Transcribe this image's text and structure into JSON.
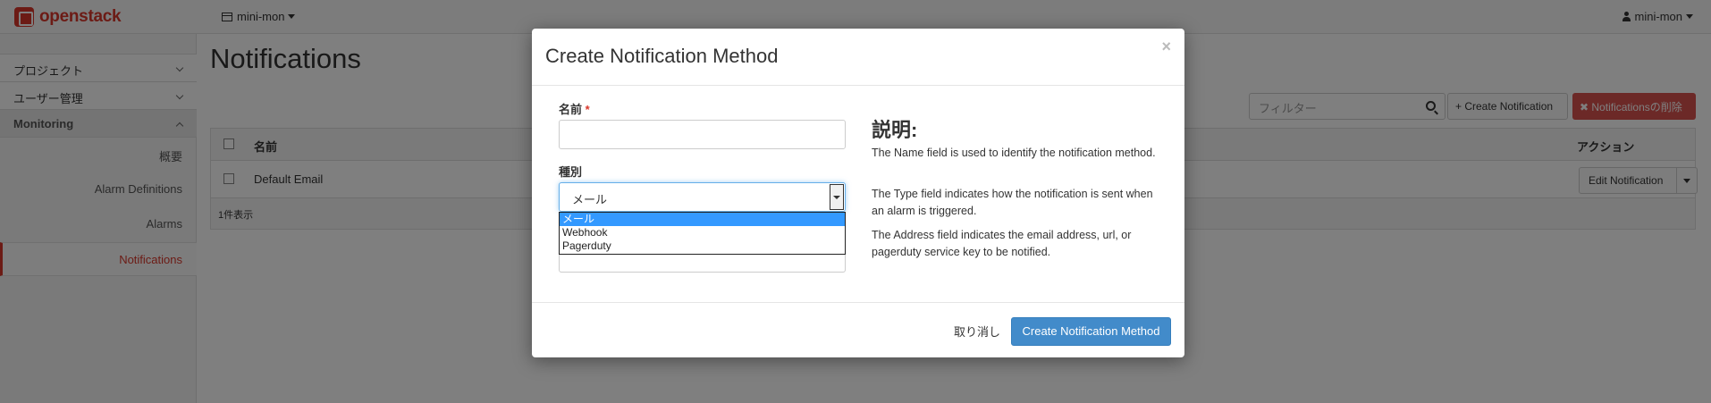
{
  "topbar": {
    "brand": "openstack",
    "project_switcher": "mini-mon",
    "user_menu": "mini-mon"
  },
  "sidebar": {
    "groups": [
      {
        "label": "プロジェクト"
      },
      {
        "label": "ユーザー管理"
      },
      {
        "label": "Monitoring"
      }
    ],
    "items": [
      {
        "label": "概要"
      },
      {
        "label": "Alarm Definitions"
      },
      {
        "label": "Alarms"
      },
      {
        "label": "Notifications"
      }
    ]
  },
  "main": {
    "title": "Notifications",
    "filter_placeholder": "フィルター",
    "create_button": "Create Notification",
    "delete_button": "Notificationsの削除",
    "table": {
      "headers": {
        "name": "名前",
        "action": "アクション"
      },
      "rows": [
        {
          "name": "Default Email",
          "action": "Edit Notification"
        }
      ],
      "footer": "1件表示"
    }
  },
  "modal": {
    "title": "Create Notification Method",
    "close": "×",
    "name_label": "名前",
    "required_mark": "*",
    "type_label": "種別",
    "type_selected": "メール",
    "type_options": [
      "メール",
      "Webhook",
      "Pagerduty"
    ],
    "help_title": "説明:",
    "help_paragraphs": [
      "The Name field is used to identify the notification method.",
      "The Type field indicates how the notification is sent when an alarm is triggered.",
      "The Address field indicates the email address, url, or pagerduty service key to be notified."
    ],
    "cancel": "取り消し",
    "submit": "Create Notification Method"
  },
  "colors": {
    "brand": "#d9372b",
    "primary": "#428bca",
    "danger": "#d9534f",
    "option_highlight": "#3399ff"
  }
}
